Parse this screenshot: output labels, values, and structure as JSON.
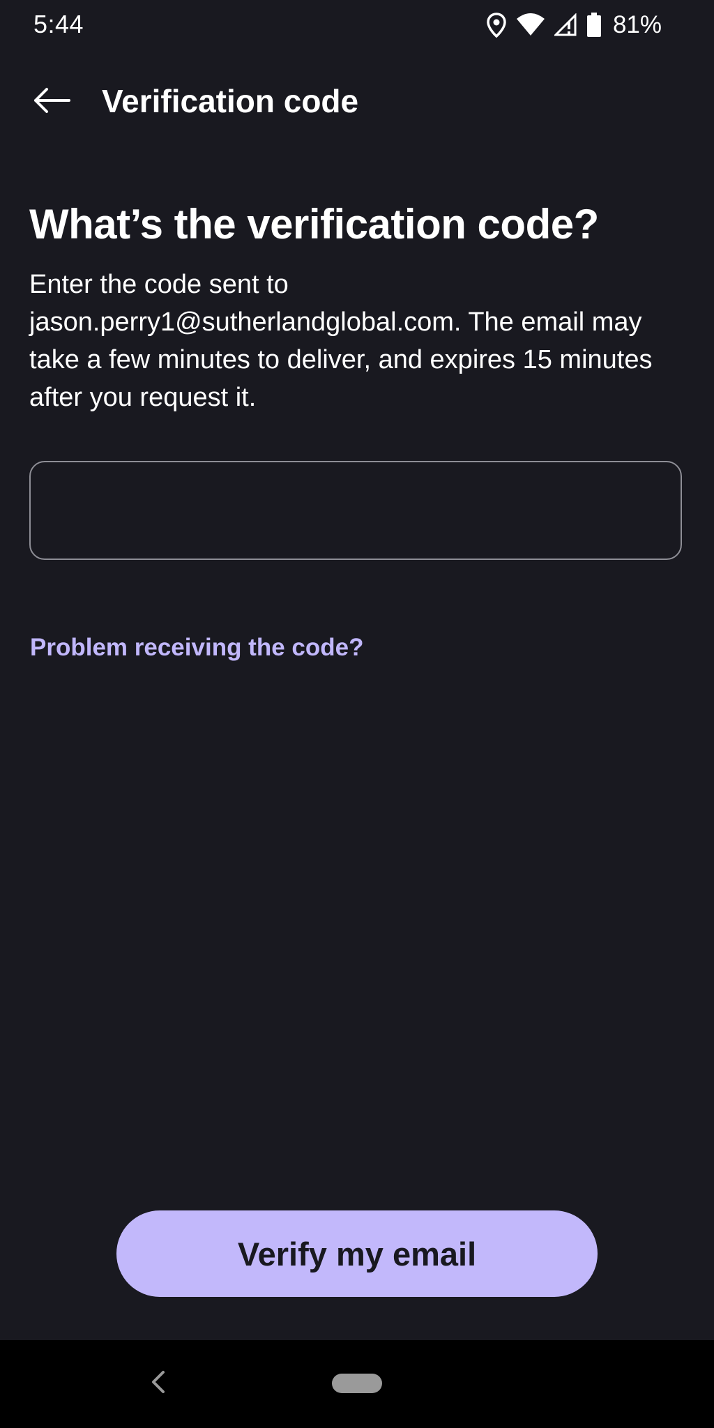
{
  "status_bar": {
    "time": "5:44",
    "battery_percent": "81%",
    "icons": [
      "location-icon",
      "wifi-icon",
      "cellular-signal-icon",
      "battery-icon"
    ]
  },
  "app_bar": {
    "back_icon": "arrow-left-icon",
    "title": "Verification code"
  },
  "main": {
    "heading": "What’s the verification code?",
    "description": "Enter the code sent to jason.perry1@sutherlandglobal.com. The email may take a few minutes to deliver, and expires 15 minutes after you request it.",
    "code_input": {
      "value": "",
      "placeholder": ""
    },
    "problem_link": "Problem receiving the code?"
  },
  "footer": {
    "verify_button_label": "Verify my email"
  },
  "nav_bar": {
    "back_icon": "chevron-left-icon",
    "home_icon": "home-pill-icon"
  },
  "colors": {
    "background": "#191920",
    "accent": "#c2b8fb",
    "link": "#c1b7fb",
    "input_border": "#8e8e96",
    "nav_background": "#000000"
  }
}
